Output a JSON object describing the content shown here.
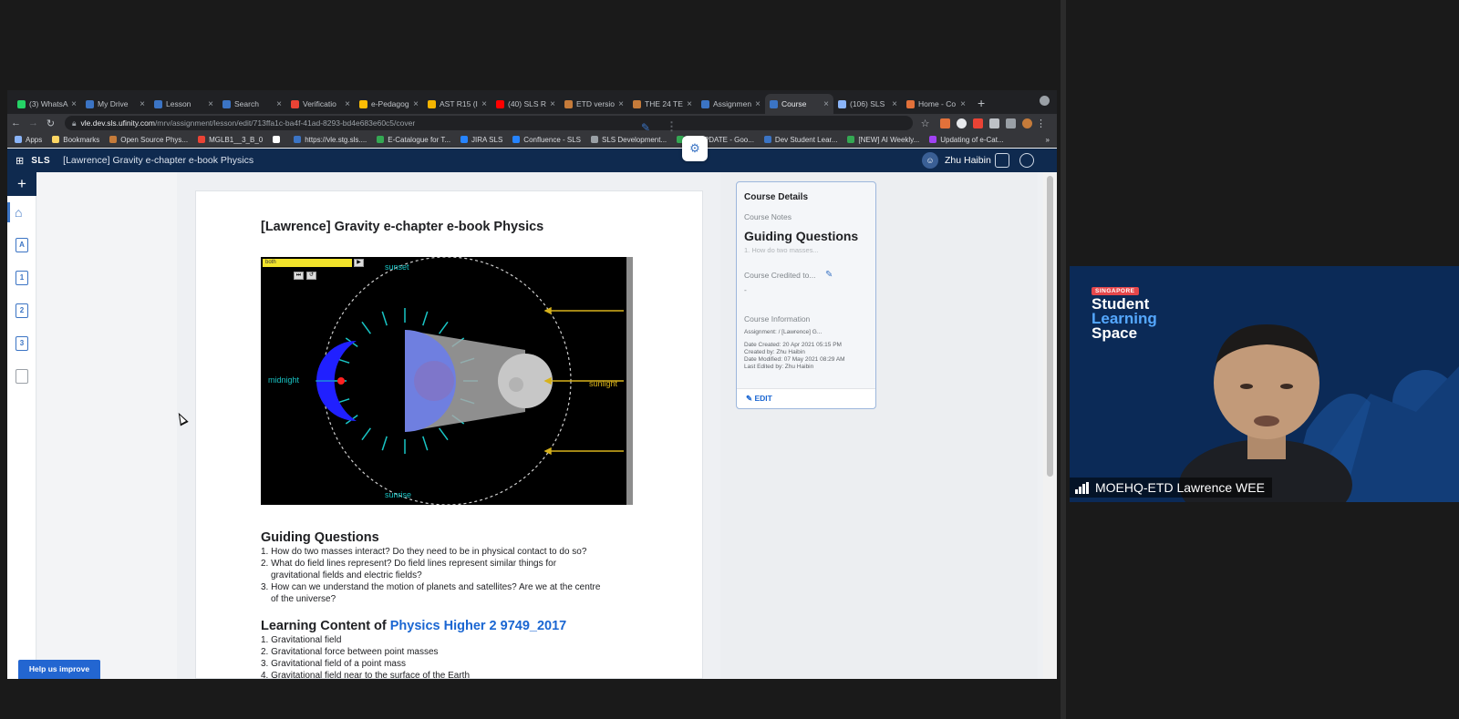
{
  "browser": {
    "tabs": [
      {
        "title": "(3) WhatsA",
        "color": "#25d366",
        "active": false
      },
      {
        "title": "My Drive",
        "color": "#3b74c4",
        "active": false
      },
      {
        "title": "Lesson",
        "color": "#3b74c4",
        "active": false
      },
      {
        "title": "Search",
        "color": "#3b74c4",
        "active": false
      },
      {
        "title": "Verificatio",
        "color": "#ea4335",
        "active": false
      },
      {
        "title": "e-Pedagog",
        "color": "#fbbc04",
        "active": false
      },
      {
        "title": "AST R15 (I",
        "color": "#f4b400",
        "active": false
      },
      {
        "title": "(40) SLS R",
        "color": "#ff0000",
        "active": false
      },
      {
        "title": "ETD versio",
        "color": "#c57b3a",
        "active": false
      },
      {
        "title": "THE 24 TE",
        "color": "#c57b3a",
        "active": false
      },
      {
        "title": "Assignmen",
        "color": "#3b74c4",
        "active": false
      },
      {
        "title": "Course",
        "color": "#3b74c4",
        "active": true
      },
      {
        "title": "(106) SLS",
        "color": "#8ab4f8",
        "active": false
      },
      {
        "title": "Home - Co",
        "color": "#e2713a",
        "active": false
      }
    ],
    "new_tab": "+",
    "url_host": "vle.dev.sls.ufinity.com",
    "url_path": "/mrv/assignment/lesson/edit/713ffa1c-ba4f-41ad-8293-bd4e683e60c5/cover",
    "bookmarks": [
      {
        "label": "Apps",
        "color": "#8ab4f8"
      },
      {
        "label": "Bookmarks",
        "color": "#fdd663"
      },
      {
        "label": "Open Source Phys...",
        "color": "#c57b3a"
      },
      {
        "label": "MGLB1__3_B_0",
        "color": "#ea4335"
      },
      {
        "label": "",
        "color": "#ffffff"
      },
      {
        "label": "https://vle.stg.sls....",
        "color": "#3b74c4"
      },
      {
        "label": "E-Catalogue for T...",
        "color": "#34a853"
      },
      {
        "label": "JIRA SLS",
        "color": "#2684ff"
      },
      {
        "label": "Confluence - SLS",
        "color": "#2684ff"
      },
      {
        "label": "SLS Development...",
        "color": "#9aa0a6"
      },
      {
        "label": "CGUPDATE - Goo...",
        "color": "#34a853"
      },
      {
        "label": "Dev Student Lear...",
        "color": "#3b74c4"
      },
      {
        "label": "[NEW] AI Weekly...",
        "color": "#34a853"
      },
      {
        "label": "Updating of e-Cat...",
        "color": "#a142f4"
      }
    ],
    "bookmarks_more": "»"
  },
  "app": {
    "logo": "SLS",
    "title": "[Lawrence] Gravity e-chapter e-book Physics",
    "user_name": "Zhu Haibin",
    "rail": {
      "add": "+",
      "items": [
        "A",
        "1",
        "2",
        "3"
      ]
    }
  },
  "content": {
    "title": "[Lawrence] Gravity e-chapter e-book Physics",
    "sim": {
      "dropdown": "both",
      "labels": {
        "sunset": "sunset",
        "midnight": "midnight",
        "sunlight": "sunlight",
        "sunrise": "sunrise"
      }
    },
    "guiding": {
      "heading": "Guiding Questions",
      "items": [
        "1. How do two masses interact? Do they need to be in physical contact to do so?",
        "2. What do field lines represent? Do field lines represent similar things for",
        "gravitational fields and electric fields?",
        "3. How can we understand the motion of planets and satellites? Are we at the centre",
        "of the universe?"
      ]
    },
    "learning": {
      "heading_prefix": "Learning Content of ",
      "heading_link": "Physics Higher 2 9749_2017",
      "items": [
        "1. Gravitational field",
        "2. Gravitational force between point masses",
        "3. Gravitational field of a point mass",
        "4. Gravitational field near to the surface of the Earth"
      ]
    }
  },
  "course_card": {
    "heading": "Course Details",
    "notes_label": "Course Notes",
    "notes_title": "Guiding Questions",
    "notes_preview": "1. How do two masses...",
    "credited_label": "Course Credited to...",
    "credited_value": "-",
    "info_label": "Course Information",
    "assignment": "Assignment:  /  [Lawrence] G...",
    "date_created": "Date Created: 20 Apr 2021 05:15 PM",
    "created_by": "Created by: Zhu Haibin",
    "date_modified": "Date Modified: 07 May 2021 08:29 AM",
    "last_edited": "Last Edited by: Zhu Haibin",
    "edit": "EDIT"
  },
  "help_button": "Help us improve",
  "video": {
    "brand_tag": "SINGAPORE",
    "brand_line1": "Student",
    "brand_line2": "Learning",
    "brand_line3": "Space",
    "participant": "MOEHQ-ETD Lawrence WEE"
  }
}
